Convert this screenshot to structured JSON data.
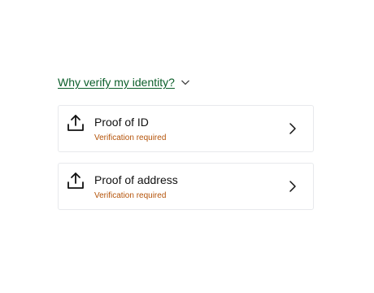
{
  "why_link": {
    "label": "Why verify my identity?",
    "icon": "chevron-down-icon"
  },
  "documents": [
    {
      "title": "Proof of ID",
      "status": "Verification required",
      "icon": "upload-icon"
    },
    {
      "title": "Proof of address",
      "status": "Verification required",
      "icon": "upload-icon"
    }
  ],
  "colors": {
    "link": "#0b5e2a",
    "status": "#b45309",
    "border": "#e7e9ec",
    "text": "#111111"
  }
}
